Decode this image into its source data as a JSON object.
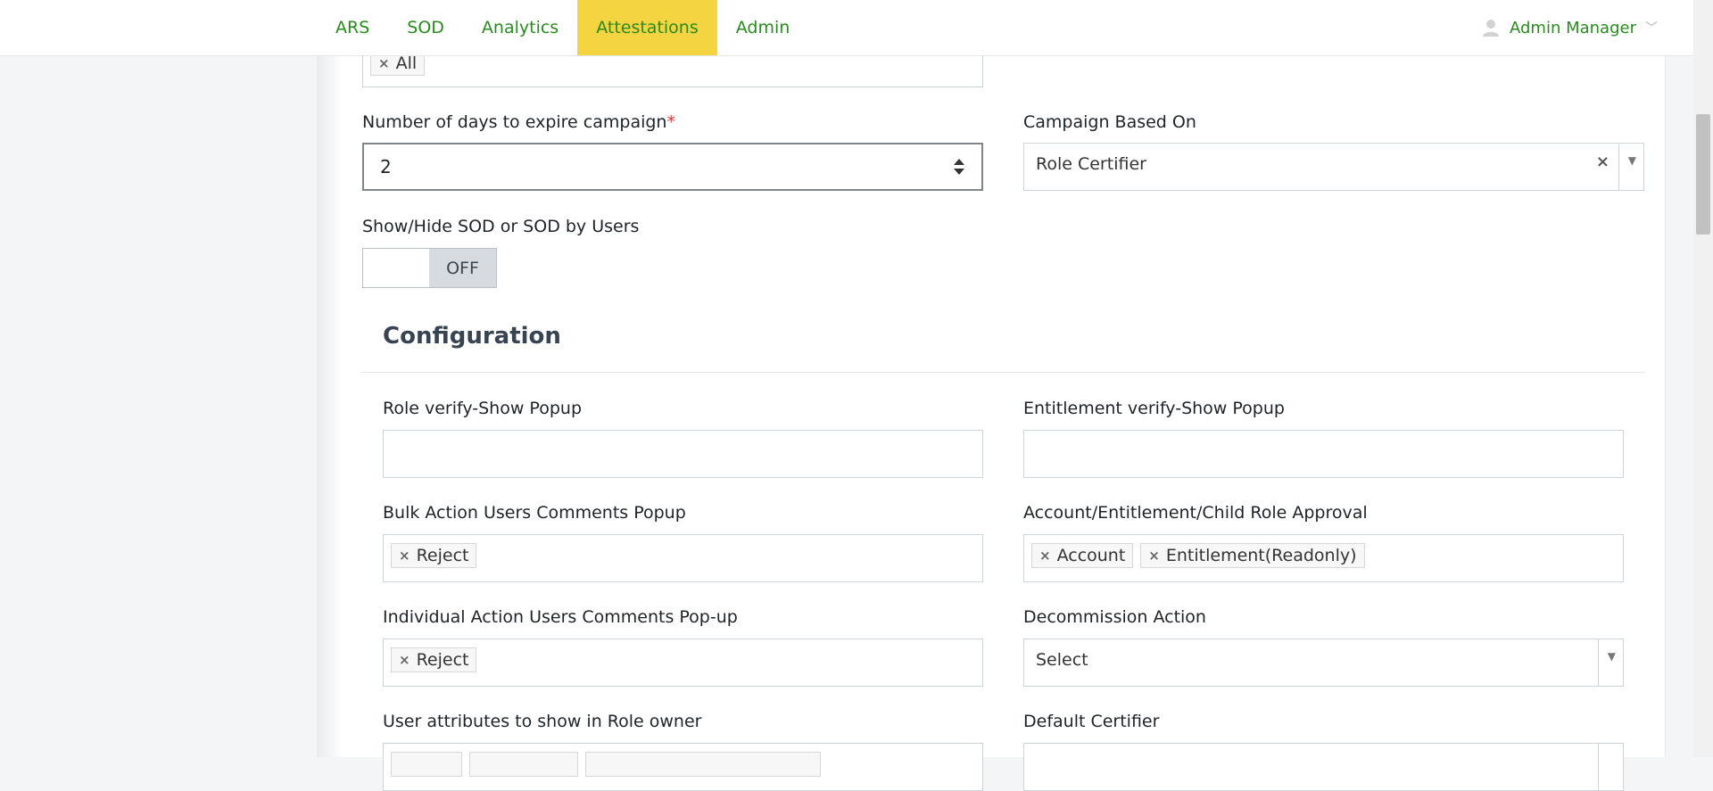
{
  "nav": {
    "items": [
      {
        "label": "ARS"
      },
      {
        "label": "SOD"
      },
      {
        "label": "Analytics"
      },
      {
        "label": "Attestations",
        "active": true
      },
      {
        "label": "Admin"
      }
    ],
    "user_name": "Admin Manager"
  },
  "form": {
    "top_tags": [
      "All"
    ],
    "expire_days": {
      "label": "Number of days to expire campaign",
      "required_mark": "*",
      "value": "2"
    },
    "campaign_based_on": {
      "label": "Campaign Based On",
      "value": "Role Certifier"
    },
    "sod_toggle": {
      "label": "Show/Hide SOD or SOD by Users",
      "state": "OFF"
    }
  },
  "config": {
    "title": "Configuration",
    "role_verify": {
      "label": "Role verify-Show Popup"
    },
    "entitlement_verify": {
      "label": "Entitlement verify-Show Popup"
    },
    "bulk_action": {
      "label": "Bulk Action Users Comments Popup",
      "tags": [
        "Reject"
      ]
    },
    "account_approval": {
      "label": "Account/Entitlement/Child Role Approval",
      "tags": [
        "Account",
        "Entitlement(Readonly)"
      ]
    },
    "individual_action": {
      "label": "Individual Action Users Comments Pop-up",
      "tags": [
        "Reject"
      ]
    },
    "decommission": {
      "label": "Decommission Action",
      "value": "Select"
    },
    "user_attributes": {
      "label": "User attributes to show in Role owner"
    },
    "default_certifier": {
      "label": "Default Certifier"
    }
  },
  "colors": {
    "accent": "#2a8a1f",
    "active_tab": "#f5d442",
    "required": "#e3342f"
  },
  "icons": {
    "tag_remove": "×",
    "dropdown": "▼",
    "user": "user-icon",
    "chevron": "chevron-down-icon"
  }
}
